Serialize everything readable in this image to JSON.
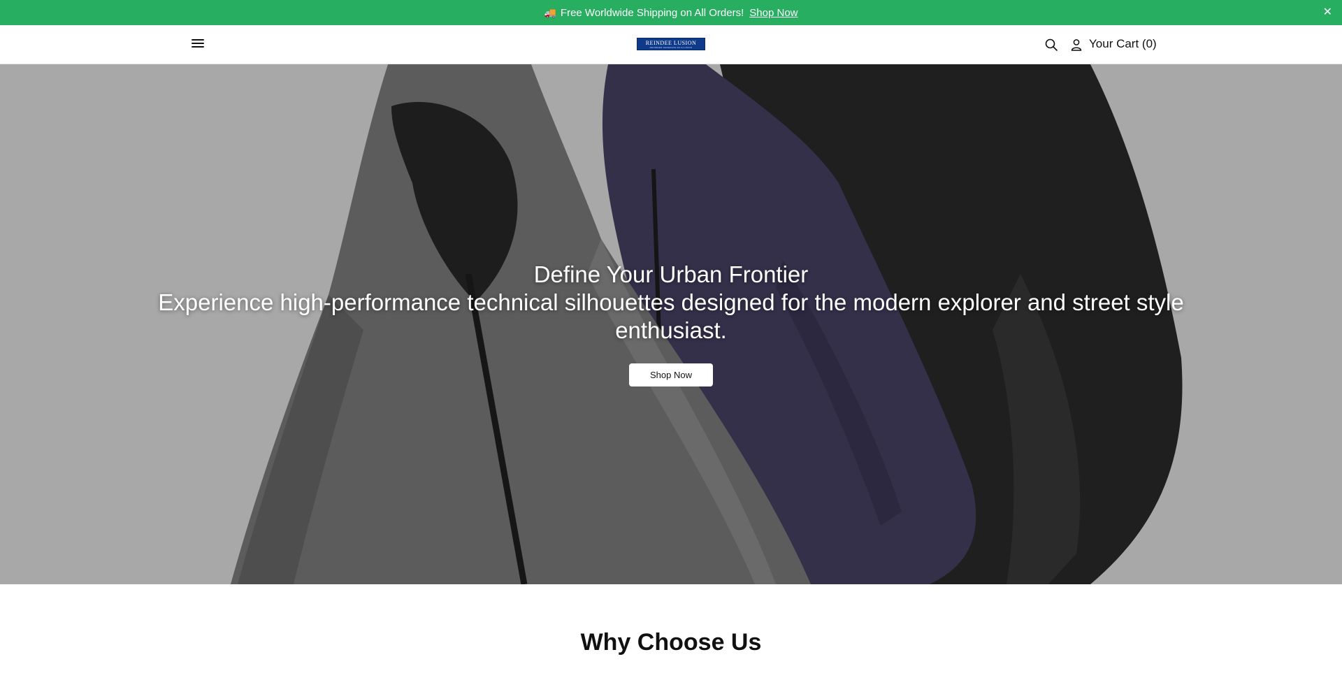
{
  "announcement": {
    "icon": "truck-icon",
    "text": "Free Worldwide Shipping on All Orders!",
    "link_label": "Shop Now",
    "background": "#27ae60"
  },
  "header": {
    "logo_text": "REINDEE LUSION",
    "logo_tagline": "REINDEER GENERATE AN ILLUSION",
    "cart_label": "Your Cart (0)"
  },
  "hero": {
    "title": "Define Your Urban Frontier",
    "subtitle": "Experience high-performance technical silhouettes designed for the modern explorer and street style enthusiast.",
    "button_label": "Shop Now"
  },
  "sections": {
    "why_title": "Why Choose Us"
  }
}
